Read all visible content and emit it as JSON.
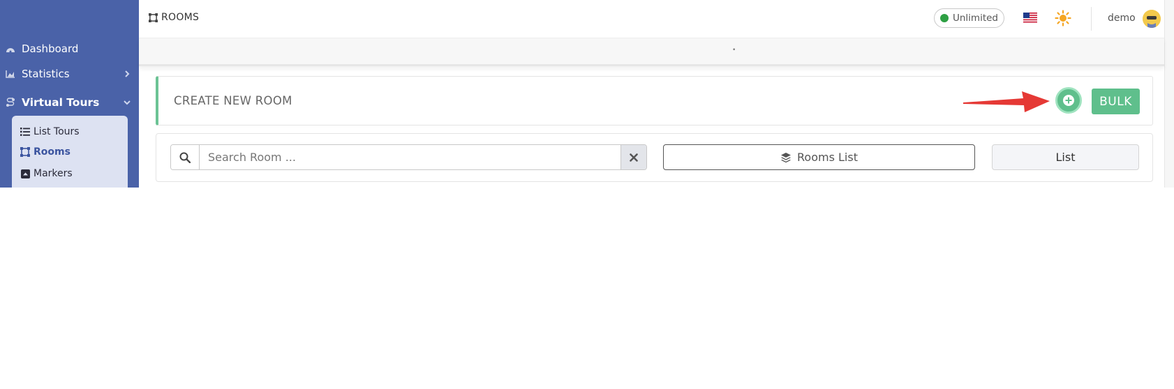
{
  "sidebar": {
    "items": [
      {
        "label": "Dashboard",
        "icon": "dashboard-icon"
      },
      {
        "label": "Statistics",
        "icon": "chart-area-icon"
      },
      {
        "label": "Virtual Tours",
        "icon": "route-icon"
      }
    ],
    "submenu": [
      {
        "label": "List Tours",
        "icon": "list-icon"
      },
      {
        "label": "Rooms",
        "icon": "vector-square-icon"
      },
      {
        "label": "Markers",
        "icon": "caret-square-up-icon"
      }
    ]
  },
  "header": {
    "breadcrumb": "ROOMS",
    "plan_badge": "Unlimited",
    "language_icon": "us-flag-icon",
    "theme_icon": "sun-icon",
    "user_name": "demo"
  },
  "create_card": {
    "title": "CREATE NEW ROOM",
    "bulk_label": "BULK"
  },
  "filters": {
    "search_placeholder": "Search Room ...",
    "rooms_list_label": "Rooms List",
    "view_label": "List"
  },
  "colors": {
    "sidebar": "#4a62a8",
    "accent_green": "#5fbf8c",
    "arrow_red": "#e53935",
    "status_green": "#2ea044"
  }
}
